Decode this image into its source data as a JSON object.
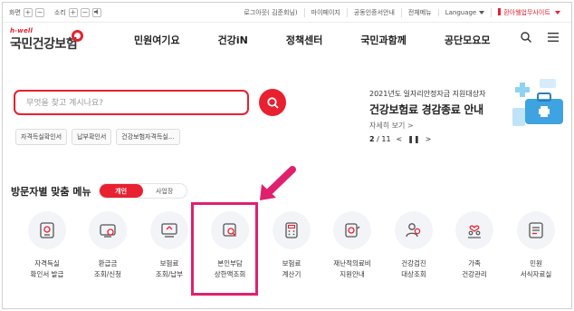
{
  "utility": {
    "font_label": "화면",
    "font_plus": "+",
    "font_minus": "−",
    "sound_label": "소리",
    "sound_plus": "+",
    "sound_minus": "−",
    "links": [
      "로그아웃( 김준회님)",
      "마이페이지",
      "공동인증서안내",
      "전체메뉴"
    ],
    "language": "Language",
    "family_site": "환아웰업무사이트"
  },
  "header": {
    "logo_top": "h-well",
    "logo_name": "국민건강보험",
    "nav": [
      "민원여기요",
      "건강iN",
      "정책센터",
      "국민과함께",
      "공단모요모"
    ]
  },
  "search": {
    "placeholder": "무엇을 찾고 계시나요?",
    "tags": [
      "자격득실확인서",
      "납부확인서",
      "건강보험자격득실..."
    ]
  },
  "banner": {
    "subtitle": "2021년도 일자리안정자금 지원대상자",
    "title": "건강보험료 경감종료 안내",
    "more": "자세히 보기 >",
    "page_current": "2",
    "page_total": "/ 11",
    "prev": "<",
    "pause": "❚❚",
    "next": ">"
  },
  "menu": {
    "title": "방문자별 맞춤 메뉴",
    "toggle": [
      "개인",
      "사업장"
    ],
    "items": [
      {
        "label": "자격득실\n확인서 발급",
        "icon": "certificate-icon"
      },
      {
        "label": "환급금\n조회/신청",
        "icon": "refund-icon"
      },
      {
        "label": "보험료\n조회/납부",
        "icon": "premium-payment-icon"
      },
      {
        "label": "본인부담\n상한액조회",
        "icon": "copay-search-icon"
      },
      {
        "label": "보험료\n계산기",
        "icon": "calculator-icon"
      },
      {
        "label": "재난적의료비\n지원안내",
        "icon": "medical-expense-icon"
      },
      {
        "label": "건강검진\n대상조회",
        "icon": "checkup-icon"
      },
      {
        "label": "가족\n건강관리",
        "icon": "family-health-icon"
      },
      {
        "label": "민원\n서식자료실",
        "icon": "forms-icon"
      }
    ]
  },
  "colors": {
    "brand_red": "#e8202f",
    "highlight": "#e0206e",
    "icon_bg": "#f2f4f7"
  }
}
